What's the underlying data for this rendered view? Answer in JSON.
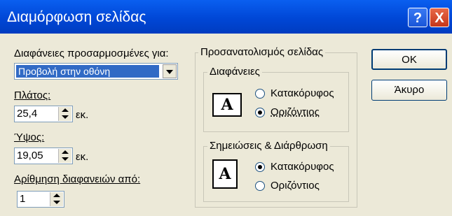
{
  "window": {
    "title": "Διαμόρφωση σελίδας",
    "help_label": "?",
    "close_label": "X"
  },
  "left": {
    "size_label": "Διαφάνειες προσαρμοσμένες για:",
    "size_value": "Προβολή στην οθόνη",
    "width_label": "Πλάτος:",
    "width_value": "25,4",
    "width_unit": "εκ.",
    "height_label": "Ύψος:",
    "height_value": "19,05",
    "height_unit": "εκ.",
    "numbering_label": "Αρίθμηση διαφανειών από:",
    "numbering_value": "1"
  },
  "orientation": {
    "group_label": "Προσανατολισμός σελίδας",
    "slides": {
      "label": "Διαφάνειες",
      "option_portrait": "Κατακόρυφος",
      "option_landscape": "Οριζόντιος",
      "selected": "landscape",
      "icon_letter": "A"
    },
    "notes": {
      "label": "Σημειώσεις & Διάρθρωση",
      "option_portrait": "Κατακόρυφος",
      "option_landscape": "Οριζόντιος",
      "selected": "portrait",
      "icon_letter": "A"
    }
  },
  "buttons": {
    "ok": "OK",
    "cancel": "Άκυρο"
  }
}
